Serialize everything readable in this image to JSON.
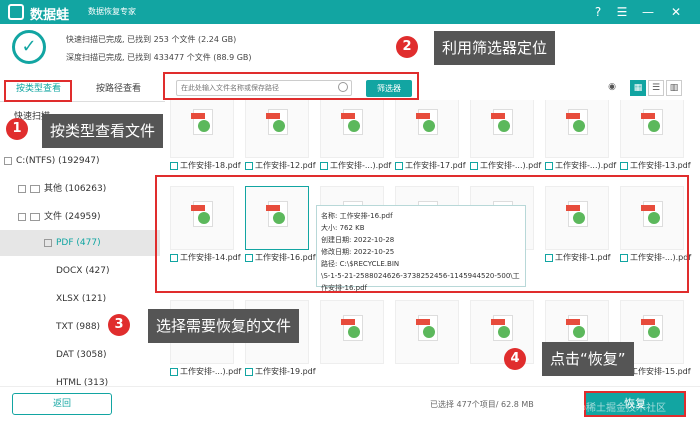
{
  "app": {
    "name": "数据蛙",
    "subtitle": "数据恢复专家"
  },
  "scan": {
    "quick": "快速扫描已完成, 已找到  253 个文件 (2.24 GB)",
    "deep": "深度扫描已完成, 已找到  433477 个文件 (88.9 GB)"
  },
  "tabs": [
    "按类型查看",
    "按路径查看"
  ],
  "search": {
    "placeholder": "在此处输入文件名称或保存路径"
  },
  "filter_label": "筛选器",
  "sidebar": {
    "quick_scan": "快速扫描",
    "drive": "C:(NTFS) (192947)",
    "other": "其他 (106263)",
    "docs": "文件 (24959)",
    "pdf": "PDF (477)",
    "docx": "DOCX (427)",
    "xlsx": "XLSX (121)",
    "txt": "TXT (988)",
    "dat": "DAT (3058)",
    "html": "HTML (313)"
  },
  "files": {
    "row1": [
      "工作安排-18.pdf",
      "工作安排-12.pdf",
      "工作安排-...).pdf",
      "工作安排-17.pdf",
      "工作安排-...).pdf",
      "工作安排-...).pdf",
      "工作安排-13.pdf"
    ],
    "row2": [
      "工作安排-14.pdf",
      "工作安排-16.pdf",
      "",
      "",
      "",
      "工作安排-1.pdf",
      "工作安排-...).pdf"
    ],
    "row3": [
      "工作安排-...).pdf",
      "工作安排-19.pdf",
      "",
      "",
      "",
      "",
      "工作安排-15.pdf"
    ]
  },
  "tooltip": {
    "name": "名称:  工作安排-16.pdf",
    "size": "大小:  762 KB",
    "created": "创建日期:  2022-10-28",
    "modified": "修改日期:  2022-10-25",
    "path1": "路径:  C:\\$RECYCLE.BIN",
    "path2": "\\S-1-5-21-2588024626-3738252456-1145944520-500\\工",
    "path3": "作安排-16.pdf"
  },
  "callouts": {
    "c1": "按类型查看文件",
    "c2": "利用筛选器定位",
    "c3": "选择需要恢复的文件",
    "c4": "点击“恢复”"
  },
  "badges": [
    "1",
    "2",
    "3",
    "4"
  ],
  "bottom": {
    "back": "返回",
    "selected": "已选择  477个项目/  62.8 MB",
    "recover": "恢复"
  },
  "watermark": "@稀土掘金技术社区"
}
